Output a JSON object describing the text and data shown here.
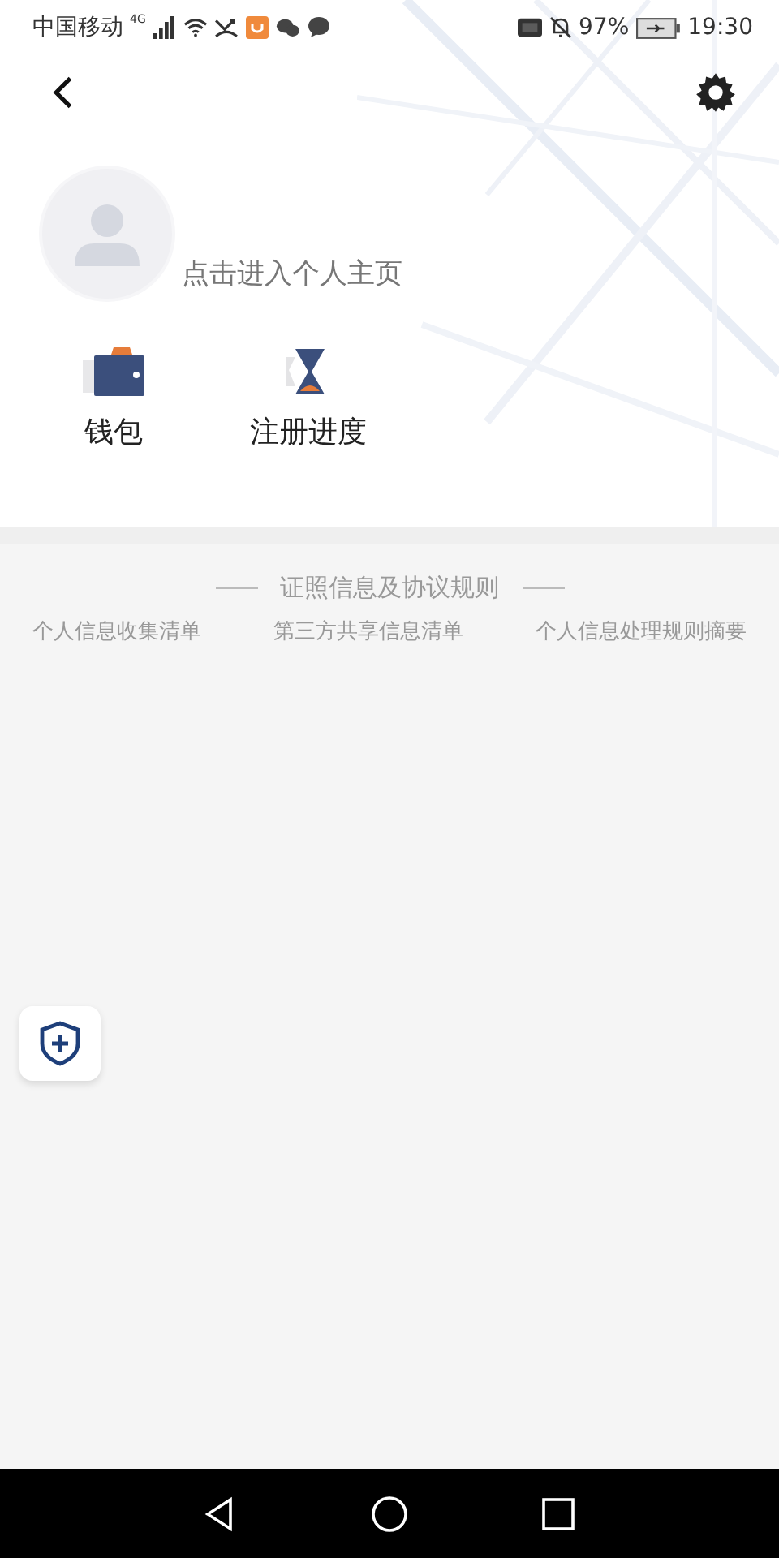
{
  "status_bar": {
    "carrier": "中国移动",
    "network": "4G",
    "battery": "97%",
    "time": "19:30"
  },
  "profile": {
    "prompt": "点击进入个人主页"
  },
  "shortcuts": [
    {
      "kind": "wallet",
      "label": "钱包"
    },
    {
      "kind": "hourglass",
      "label": "注册进度"
    }
  ],
  "legal": {
    "title": "证照信息及协议规则",
    "links": [
      "个人信息收集清单",
      "第三方共享信息清单",
      "个人信息处理规则摘要"
    ]
  }
}
